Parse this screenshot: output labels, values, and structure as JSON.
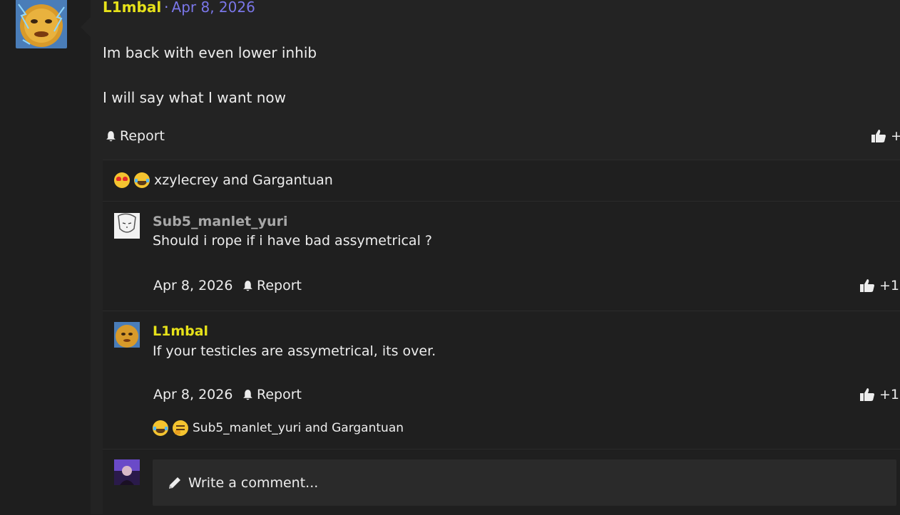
{
  "post": {
    "author": "L1mbal",
    "separator": "·",
    "date": "Apr 8, 2026",
    "lines": [
      "Im back with even lower inhib",
      "I will say what I want now"
    ],
    "report_label": "Report",
    "like_count": "+",
    "reactions_text": "xzylecrey and Gargantuan",
    "reaction_icons": [
      "star-struck-emoji",
      "crying-laughing-emoji"
    ]
  },
  "comments": [
    {
      "author": "Sub5_manlet_yuri",
      "author_color": "#a8a8a8",
      "text": "Should i rope if i have bad assymetrical ?",
      "date": "Apr 8, 2026",
      "report_label": "Report",
      "like_count": "+1"
    },
    {
      "author": "L1mbal",
      "author_color": "#e6e11a",
      "text": "If your testicles are assymetrical, its over.",
      "date": "Apr 8, 2026",
      "report_label": "Report",
      "like_count": "+1",
      "reactions_text": "Sub5_manlet_yuri and Gargantuan",
      "reaction_icons": [
        "crying-laughing-emoji",
        "thinking-emoji"
      ]
    }
  ],
  "composer": {
    "placeholder": "Write a comment..."
  },
  "colors": {
    "accent_name": "#e6e11a",
    "date_link": "#7a76e8",
    "background": "#1e1e1e",
    "panel": "#232323"
  }
}
